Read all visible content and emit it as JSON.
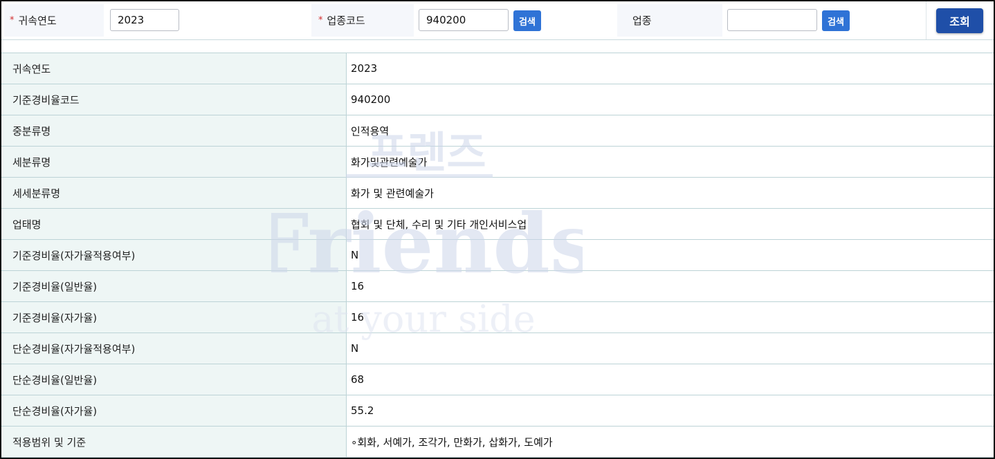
{
  "search": {
    "year_label": "귀속연도",
    "year_value": "2023",
    "code_label": "업종코드",
    "code_value": "940200",
    "code_search_label": "검색",
    "industry_label": "업종",
    "industry_value": "",
    "industry_search_label": "검색",
    "query_label": "조회",
    "required_mark": "*"
  },
  "rows": [
    {
      "key": "귀속연도",
      "value": "2023"
    },
    {
      "key": "기준경비율코드",
      "value": "940200"
    },
    {
      "key": "중분류명",
      "value": "인적용역"
    },
    {
      "key": "세분류명",
      "value": "화가및관련예술가"
    },
    {
      "key": "세세분류명",
      "value": "화가 및 관련예술가"
    },
    {
      "key": "업태명",
      "value": "협회 및 단체, 수리 및 기타 개인서비스업"
    },
    {
      "key": "기준경비율(자가율적용여부)",
      "value": "N"
    },
    {
      "key": "기준경비율(일반율)",
      "value": "16"
    },
    {
      "key": "기준경비율(자가율)",
      "value": "16"
    },
    {
      "key": "단순경비율(자가율적용여부)",
      "value": "N"
    },
    {
      "key": "단순경비율(일반율)",
      "value": "68"
    },
    {
      "key": "단순경비율(자가율)",
      "value": "55.2"
    },
    {
      "key": "적용범위 및 기준",
      "value": "∘회화, 서예가, 조각가, 만화가, 삽화가, 도예가"
    }
  ],
  "watermark": {
    "line1": "프렌즈",
    "line2": "Friends",
    "line3": "at your side",
    "color": "#cdd6ea"
  }
}
